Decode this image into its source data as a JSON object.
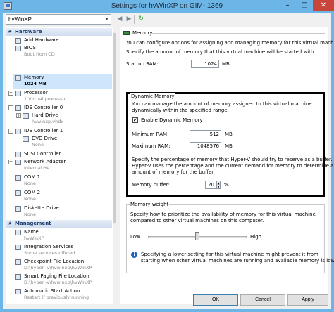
{
  "window": {
    "title": "Settings for hvWinXP on GIM-I1369",
    "minimize": "–",
    "maximize": "□",
    "close": "✕"
  },
  "toolbar": {
    "vm_selected": "hvWinXP",
    "back_glyph": "◀",
    "forward_glyph": "▶",
    "refresh_glyph": "↻"
  },
  "sidebar": {
    "hardware_header": "Hardware",
    "management_header": "Management",
    "hardware_items": [
      {
        "label": "Add Hardware",
        "sub": ""
      },
      {
        "label": "BIOS",
        "sub": "Boot from CD"
      },
      {
        "label": "Memory",
        "sub": "1024 MB"
      },
      {
        "label": "Processor",
        "sub": "1 Virtual processor"
      },
      {
        "label": "IDE Controller 0",
        "sub": ""
      },
      {
        "label": "Hard Drive",
        "sub": "hvwinxp.vhdx"
      },
      {
        "label": "IDE Controller 1",
        "sub": ""
      },
      {
        "label": "DVD Drive",
        "sub": "None"
      },
      {
        "label": "SCSI Controller",
        "sub": ""
      },
      {
        "label": "Network Adapter",
        "sub": "Internal HV"
      },
      {
        "label": "COM 1",
        "sub": "None"
      },
      {
        "label": "COM 2",
        "sub": "None"
      },
      {
        "label": "Diskette Drive",
        "sub": "None"
      }
    ],
    "management_items": [
      {
        "label": "Name",
        "sub": "hvWinXP"
      },
      {
        "label": "Integration Services",
        "sub": "Some services offered"
      },
      {
        "label": "Checkpoint File Location",
        "sub": "D:\\hyper -v\\hvwinxp\\hvWinXP"
      },
      {
        "label": "Smart Paging File Location",
        "sub": "D:\\hyper -v\\hvwinxp\\hvWinXP"
      },
      {
        "label": "Automatic Start Action",
        "sub": "Restart if previously running"
      }
    ]
  },
  "memory": {
    "header": "Memory",
    "intro": "You can configure options for assigning and managing memory for this virtual machine.",
    "startup_desc": "Specify the amount of memory that this virtual machine will be started with.",
    "startup_label": "Startup RAM:",
    "startup_value": "1024",
    "unit": "MB",
    "dynamic": {
      "legend": "Dynamic Memory",
      "desc1": "You can manage the amount of memory assigned to this virtual machine",
      "desc2": "dynamically within the specified range.",
      "enable_label": "Enable Dynamic Memory",
      "enabled": true,
      "min_label": "Minimum RAM:",
      "min_value": "512",
      "max_label": "Maximum RAM:",
      "max_value": "1048576",
      "buffer_desc1": "Specify the percentage of memory that Hyper-V should try to reserve as a buffer.",
      "buffer_desc2": "Hyper-V uses the percentage and the current demand for memory to determine an",
      "buffer_desc3": "amount of memory for the buffer.",
      "buffer_label": "Memory buffer:",
      "buffer_value": "20",
      "percent": "%"
    },
    "weight": {
      "legend": "Memory weight",
      "desc1": "Specify how to prioritize the availability of memory for this virtual machine",
      "desc2": "compared to other virtual machines on this computer.",
      "low": "Low",
      "high": "High",
      "level": 0.5,
      "info1": "Specifying a lower setting for this virtual machine might prevent it from",
      "info2": "starting when other virtual machines are running and available memory is low."
    }
  },
  "buttons": {
    "ok": "OK",
    "cancel": "Cancel",
    "apply": "Apply"
  },
  "colors": {
    "title_bar": "#6cb5e7",
    "selection": "#cde6fb",
    "close_button": "#c7453a"
  }
}
